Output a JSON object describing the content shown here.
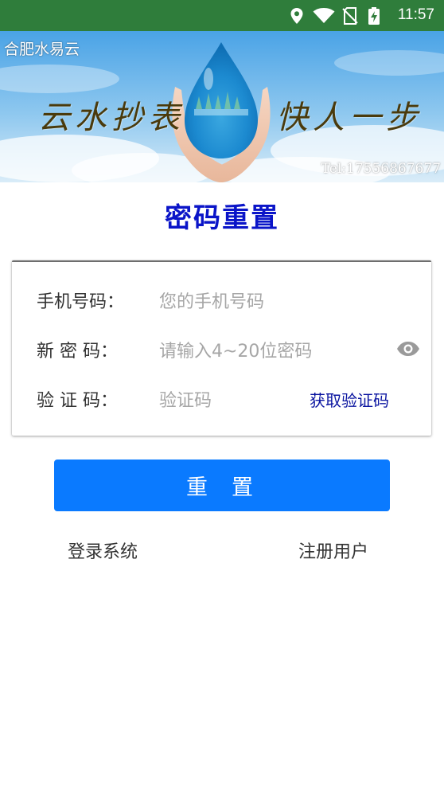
{
  "status_bar": {
    "time": "11:57",
    "icons": [
      "location-icon",
      "wifi-icon",
      "no-sim-icon",
      "battery-charging-icon"
    ],
    "background": "#2f7d3b"
  },
  "banner": {
    "brand": "合肥水易云",
    "slogan_left": "云水抄表",
    "slogan_right": "快人一步",
    "tel": "Tel:17556867677"
  },
  "page": {
    "title": "密码重置",
    "title_color": "#0a14c8"
  },
  "form": {
    "phone": {
      "label": "手机号码：",
      "placeholder": "您的手机号码",
      "value": ""
    },
    "password": {
      "label": "新 密 码：",
      "placeholder": "请输入4~20位密码",
      "value": ""
    },
    "code": {
      "label": "验 证 码：",
      "placeholder": "验证码",
      "value": "",
      "get_code_label": "获取验证码"
    }
  },
  "actions": {
    "reset_label": "重置",
    "reset_color": "#0a7aff",
    "login_label": "登录系统",
    "register_label": "注册用户"
  }
}
